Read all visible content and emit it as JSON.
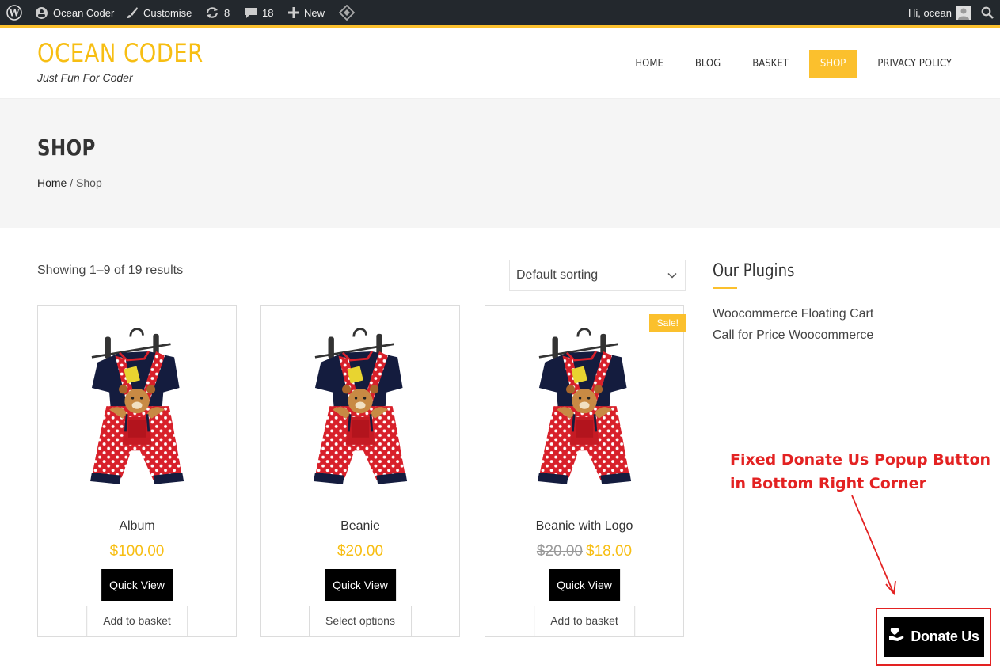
{
  "admin_bar": {
    "site_name": "Ocean Coder",
    "customise": "Customise",
    "updates_count": "8",
    "comments_count": "18",
    "new_label": "New",
    "greeting": "Hi, ocean"
  },
  "header": {
    "site_title": "OCEAN CODER",
    "tagline": "Just Fun For Coder",
    "nav": [
      "HOME",
      "BLOG",
      "BASKET",
      "SHOP",
      "PRIVACY POLICY"
    ],
    "active_nav": "SHOP"
  },
  "page": {
    "title": "SHOP",
    "breadcrumb_home": "Home",
    "breadcrumb_sep": " / ",
    "breadcrumb_current": "Shop"
  },
  "shop": {
    "result_count": "Showing 1–9 of 19 results",
    "sorting_selected": "Default sorting",
    "products": [
      {
        "name": "Album",
        "price": "$100.00",
        "old_price": "",
        "quick_view": "Quick View",
        "action": "Add to basket",
        "badge": ""
      },
      {
        "name": "Beanie",
        "price": "$20.00",
        "old_price": "",
        "quick_view": "Quick View",
        "action": "Select options",
        "badge": ""
      },
      {
        "name": "Beanie with Logo",
        "price": "$18.00",
        "old_price": "$20.00",
        "quick_view": "Quick View",
        "action": "Add to basket",
        "badge": "Sale!"
      }
    ]
  },
  "sidebar": {
    "widget_title": "Our Plugins",
    "links": [
      "Woocommerce Floating Cart",
      "Call for Price Woocommerce"
    ]
  },
  "annotation": {
    "line1": "Fixed Donate Us Popup Button",
    "line2": "in Bottom Right Corner"
  },
  "donate": {
    "label": "Donate Us"
  },
  "colors": {
    "accent": "#fbc02d",
    "title": "#f7be13",
    "annotation": "#e32222",
    "admin_bar": "#23282d"
  },
  "icons": [
    "wordpress-icon",
    "site-icon",
    "brush-icon",
    "updates-icon",
    "comments-icon",
    "plus-icon",
    "diamond-icon",
    "avatar-icon",
    "search-icon",
    "chevron-down-icon",
    "donate-hand-heart-icon"
  ]
}
